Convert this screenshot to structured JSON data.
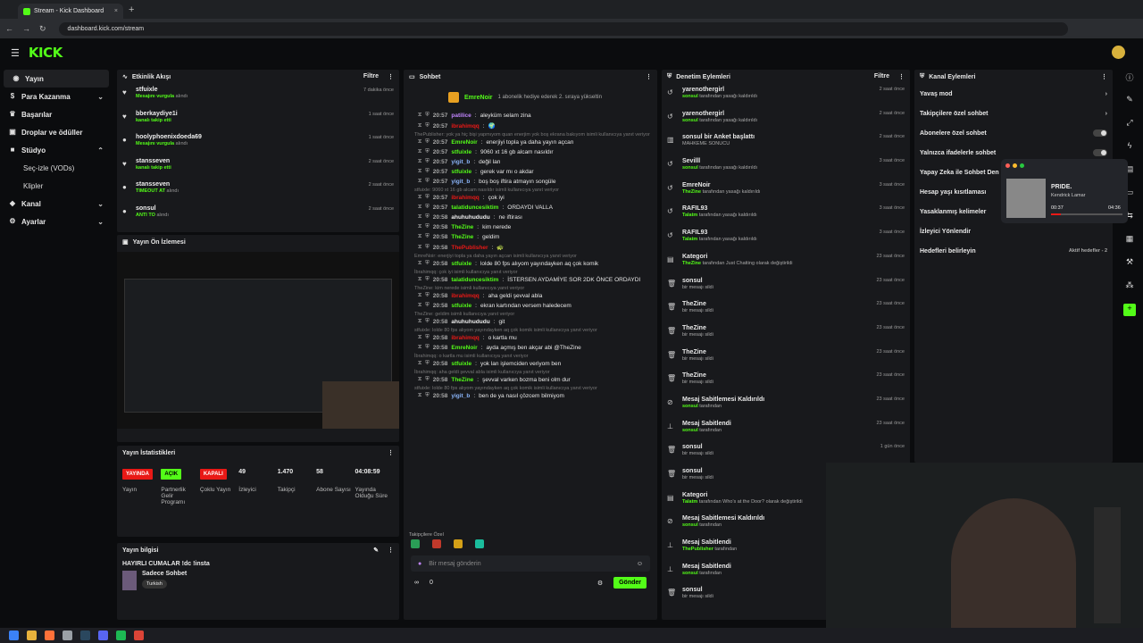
{
  "browser": {
    "tab_title": "Stream - Kick Dashboard",
    "url": "dashboard.kick.com/stream"
  },
  "brand": {
    "logo": "KICK",
    "accent": "#53fc18"
  },
  "sidebar": {
    "items": [
      {
        "label": "Yayın",
        "icon": "broadcast-icon"
      },
      {
        "label": "Para Kazanma",
        "icon": "money-icon"
      },
      {
        "label": "Başarılar",
        "icon": "trophy-icon"
      },
      {
        "label": "Droplar ve ödüller",
        "icon": "gift-icon"
      },
      {
        "label": "Stüdyo",
        "icon": "studio-icon"
      },
      {
        "label": "Kanal",
        "icon": "channel-icon"
      },
      {
        "label": "Ayarlar",
        "icon": "gear-icon"
      }
    ],
    "sub": [
      "Seç-izle (VODs)",
      "Klipler"
    ]
  },
  "activity": {
    "title": "Etkinlik Akışı",
    "filter": "Filtre",
    "items": [
      {
        "name": "stfuixle",
        "sub": "Mesajını vurgula",
        "sub2": "alındı",
        "time": "7 dakika önce"
      },
      {
        "name": "bberkaydiye1i",
        "sub": "kanalı takip etti",
        "sub2": "",
        "time": "1 saat önce"
      },
      {
        "name": "hoolyphoenixdoeda69",
        "sub": "Mesajını vurgula",
        "sub2": "alındı",
        "time": "1 saat önce"
      },
      {
        "name": "stansseven",
        "sub": "kanalı takip etti",
        "sub2": "",
        "time": "2 saat önce"
      },
      {
        "name": "stansseven",
        "sub": "TIMEOUT AT",
        "sub2": "alındı",
        "time": "2 saat önce"
      },
      {
        "name": "sonsul",
        "sub": "ANTI TO",
        "sub2": "alındı",
        "time": "2 saat önce"
      }
    ]
  },
  "preview": {
    "title": "Yayın Ön İzlemesi"
  },
  "stats": {
    "title": "Yayın İstatistikleri",
    "items": [
      {
        "value": "YAYINDA",
        "label": "Yayın",
        "color": "#e91916"
      },
      {
        "value": "AÇIK",
        "label": "Partnerlik Gelir Programı",
        "color": "#53fc18"
      },
      {
        "value": "KAPALI",
        "label": "Çoklu Yayın",
        "color": "#e91916"
      },
      {
        "value": "49",
        "label": "İzleyici"
      },
      {
        "value": "1.470",
        "label": "Takipçi"
      },
      {
        "value": "58",
        "label": "Abone Sayısı"
      },
      {
        "value": "04:08:59",
        "label": "Yayında Olduğu Süre"
      }
    ]
  },
  "info": {
    "title": "Yayın bilgisi",
    "stream_title": "HAYIRLI CUMALAR !dc !insta",
    "category": "Sadece Sohbet",
    "tag": "Turkish"
  },
  "chat": {
    "title": "Sohbet",
    "pinned_user": "EmreNoir",
    "pinned_text": "1 abonelik hediye ederek 2. sıraya yükseltin",
    "lines": [
      {
        "reply": "",
        "time": "20:57",
        "user": "patilice",
        "color": "#c084fc",
        "msg": "aleyküm selam zina"
      },
      {
        "reply": "",
        "time": "20:57",
        "user": "ibrahimqq",
        "color": "#e91916",
        "msg": "🌍"
      },
      {
        "reply": "ThePublisher: yok ya hiç bişi yapmıyom quan enerjim yok boş ekrana bakıyom isimli kullanıcıya yanıt veriyor",
        "time": "20:57",
        "user": "EmreNoir",
        "color": "#53fc18",
        "msg": "enerjiyi topla ya daha yayın açcan"
      },
      {
        "reply": "",
        "time": "20:57",
        "user": "stfuixle",
        "color": "#53fc18",
        "msg": "9060 xt 16 gb alcam nasıldır"
      },
      {
        "reply": "",
        "time": "20:57",
        "user": "yigit_b",
        "color": "#8ab4f8",
        "msg": "değil lan"
      },
      {
        "reply": "",
        "time": "20:57",
        "user": "stfuixle",
        "color": "#53fc18",
        "msg": "gerek var mı o akdar"
      },
      {
        "reply": "",
        "time": "20:57",
        "user": "yigit_b",
        "color": "#8ab4f8",
        "msg": "boş boş iftira atmayın songüle"
      },
      {
        "reply": "stfuixle: 9060 xt 16 gb alcam nasıldır isimli kullanıcıya yanıt veriyor",
        "time": "20:57",
        "user": "ibrahimqq",
        "color": "#e91916",
        "msg": "çok iyi"
      },
      {
        "reply": "",
        "time": "20:57",
        "user": "talatiduncesiktim",
        "color": "#53fc18",
        "msg": "ORDAYDI VALLA"
      },
      {
        "reply": "",
        "time": "20:58",
        "user": "ahuhuhududu",
        "color": "#eee",
        "msg": "ne iftirası"
      },
      {
        "reply": "",
        "time": "20:58",
        "user": "TheZine",
        "color": "#53fc18",
        "msg": "kim nerede"
      },
      {
        "reply": "",
        "time": "20:58",
        "user": "TheZine",
        "color": "#53fc18",
        "msg": "geldim"
      },
      {
        "reply": "",
        "time": "20:58",
        "user": "ThePublisher",
        "color": "#e91916",
        "msg": "🐢"
      },
      {
        "reply": "EmreNoir: enerjiyi topla ya daha yayın açcan isimli kullanıcıya yanıt veriyor",
        "time": "20:58",
        "user": "stfuixle",
        "color": "#53fc18",
        "msg": "lolde 80 fps alıyom yayındayken aq çok komik"
      },
      {
        "reply": "İbrahimqq: çok iyi isimli kullanıcıya yanıt veriyor",
        "time": "20:58",
        "user": "talatiduncesiktim",
        "color": "#53fc18",
        "msg": "İSTERSEN AYDAMİYE SOR 2DK ÖNCE ORDAYDI"
      },
      {
        "reply": "TheZine: kim nerede isimli kullanıcıya yanıt veriyor",
        "time": "20:58",
        "user": "ibrahimqq",
        "color": "#e91916",
        "msg": "aha geldi şevval abla"
      },
      {
        "reply": "",
        "time": "20:58",
        "user": "stfuixle",
        "color": "#53fc18",
        "msg": "ekran kartından versem haledecem"
      },
      {
        "reply": "TheZine: geldim isimli kullanıcıya yanıt veriyor",
        "time": "20:58",
        "user": "ahuhuhududu",
        "color": "#eee",
        "msg": "git"
      },
      {
        "reply": "stfuixle: lolde 80 fps alıyom yayındayken aq çok komik isimli kullanıcıya yanıt veriyor",
        "time": "20:58",
        "user": "ibrahimqq",
        "color": "#e91916",
        "msg": "o kartla mu"
      },
      {
        "reply": "",
        "time": "20:58",
        "user": "EmreNoir",
        "color": "#53fc18",
        "msg": "ayda açmış ben akçar abi @TheZine"
      },
      {
        "reply": "İbrahimqq: o kartla mu isimli kullanıcıya yanıt veriyor",
        "time": "20:58",
        "user": "stfuixle",
        "color": "#53fc18",
        "msg": "yok lan işlemciden veriyom ben"
      },
      {
        "reply": "İbrahimqq: aha geldi şevval abla isimli kullanıcıya yanıt veriyor",
        "time": "20:58",
        "user": "TheZine",
        "color": "#53fc18",
        "msg": "şevval varken bozma beni olm dur"
      },
      {
        "reply": "stfuixle: lolde 80 fps alıyom yayındayken aq çok komik isimli kullanıcıya yanıt veriyor",
        "time": "20:58",
        "user": "yigit_b",
        "color": "#8ab4f8",
        "msg": "ben de ya nasıl çözcem bilmiyom"
      }
    ],
    "emote_label": "Takipçilere Özel",
    "input_placeholder": "Bir mesaj gönderin",
    "count": "0",
    "send": "Gönder"
  },
  "moderation": {
    "title": "Denetim Eylemleri",
    "filter": "Filtre",
    "items": [
      {
        "icon": "undo-icon",
        "name": "yarenothergirl",
        "sub": "sonsul",
        "sub2": "tarafından yasağı kaldırıldı",
        "time": "2 saat önce"
      },
      {
        "icon": "undo-icon",
        "name": "yarenothergirl",
        "sub": "sonsul",
        "sub2": "tarafından yasağı kaldırıldı",
        "time": "2 saat önce"
      },
      {
        "icon": "poll-icon",
        "name": "sonsul bir Anket başlattı",
        "sub": "",
        "sub2": "MAHKEME SONUCU",
        "time": "2 saat önce"
      },
      {
        "icon": "undo-icon",
        "name": "Sevilll",
        "sub": "sonsul",
        "sub2": "tarafından yasağı kaldırıldı",
        "time": "3 saat önce"
      },
      {
        "icon": "undo-icon",
        "name": "EmreNoir",
        "sub": "TheZine",
        "sub2": "tarafından yasağı kaldırıldı",
        "time": "3 saat önce"
      },
      {
        "icon": "undo-icon",
        "name": "RAFIL93",
        "sub": "Talatm",
        "sub2": "tarafından yasağı kaldırıldı",
        "time": "3 saat önce"
      },
      {
        "icon": "undo-icon",
        "name": "RAFIL93",
        "sub": "Talatm",
        "sub2": "tarafından yasağı kaldırıldı",
        "time": "3 saat önce"
      },
      {
        "icon": "category-icon",
        "name": "Kategori",
        "sub": "TheZine",
        "sub2": "tarafından Just Chatting olarak değiştirildi",
        "time": "23 saat önce"
      },
      {
        "icon": "trash-icon",
        "name": "sonsul",
        "sub": "",
        "sub2": "bir mesajı sildi",
        "time": "23 saat önce"
      },
      {
        "icon": "trash-icon",
        "name": "TheZine",
        "sub": "",
        "sub2": "bir mesajı sildi",
        "time": "23 saat önce"
      },
      {
        "icon": "trash-icon",
        "name": "TheZine",
        "sub": "",
        "sub2": "bir mesajı sildi",
        "time": "23 saat önce"
      },
      {
        "icon": "trash-icon",
        "name": "TheZine",
        "sub": "",
        "sub2": "bir mesajı sildi",
        "time": "23 saat önce"
      },
      {
        "icon": "trash-icon",
        "name": "TheZine",
        "sub": "",
        "sub2": "bir mesajı sildi",
        "time": "23 saat önce"
      },
      {
        "icon": "unpin-icon",
        "name": "Mesaj Sabitlemesi Kaldırıldı",
        "sub": "sonsul",
        "sub2": "tarafından",
        "time": "23 saat önce"
      },
      {
        "icon": "pin-icon",
        "name": "Mesaj Sabitlendi",
        "sub": "sonsul",
        "sub2": "tarafından",
        "time": "23 saat önce"
      },
      {
        "icon": "trash-icon",
        "name": "sonsul",
        "sub": "",
        "sub2": "bir mesajı sildi",
        "time": "1 gün önce"
      },
      {
        "icon": "trash-icon",
        "name": "sonsul",
        "sub": "",
        "sub2": "bir mesajı sildi",
        "time": ""
      },
      {
        "icon": "category-icon",
        "name": "Kategori",
        "sub": "Talatm",
        "sub2": "tarafından Who's at the Door? olarak değiştirildi",
        "time": ""
      },
      {
        "icon": "unpin-icon",
        "name": "Mesaj Sabitlemesi Kaldırıldı",
        "sub": "sonsul",
        "sub2": "tarafından",
        "time": ""
      },
      {
        "icon": "pin-icon",
        "name": "Mesaj Sabitlendi",
        "sub": "ThePublisher",
        "sub2": "tarafından",
        "time": ""
      },
      {
        "icon": "pin-icon",
        "name": "Mesaj Sabitlendi",
        "sub": "sonsul",
        "sub2": "tarafından",
        "time": ""
      },
      {
        "icon": "trash-icon",
        "name": "sonsul",
        "sub": "",
        "sub2": "bir mesajı sildi",
        "time": ""
      }
    ]
  },
  "channel": {
    "title": "Kanal Eylemleri",
    "items": [
      {
        "label": "Yavaş mod",
        "ctrl": "arrow"
      },
      {
        "label": "Takipçilere özel sohbet",
        "ctrl": "arrow"
      },
      {
        "label": "Abonelere özel sohbet",
        "ctrl": "toggle"
      },
      {
        "label": "Yalnızca ifadelerle sohbet",
        "ctrl": "toggle"
      },
      {
        "label": "Yapay Zeka ile Sohbet Den",
        "ctrl": ""
      },
      {
        "label": "Hesap yaşı kısıtlaması",
        "ctrl": ""
      },
      {
        "label": "Yasaklanmış kelimeler",
        "ctrl": ""
      },
      {
        "label": "İzleyici Yönlendir",
        "ctrl": ""
      },
      {
        "label": "Hedefleri belirleyin",
        "ctrl": "goal"
      }
    ],
    "goal_text": "Aktif hedefler - 2"
  },
  "music": {
    "title": "PRIDE.",
    "artist": "Kendrick Lamar",
    "elapsed": "00:37",
    "total": "04:36",
    "progress": 0.134
  }
}
